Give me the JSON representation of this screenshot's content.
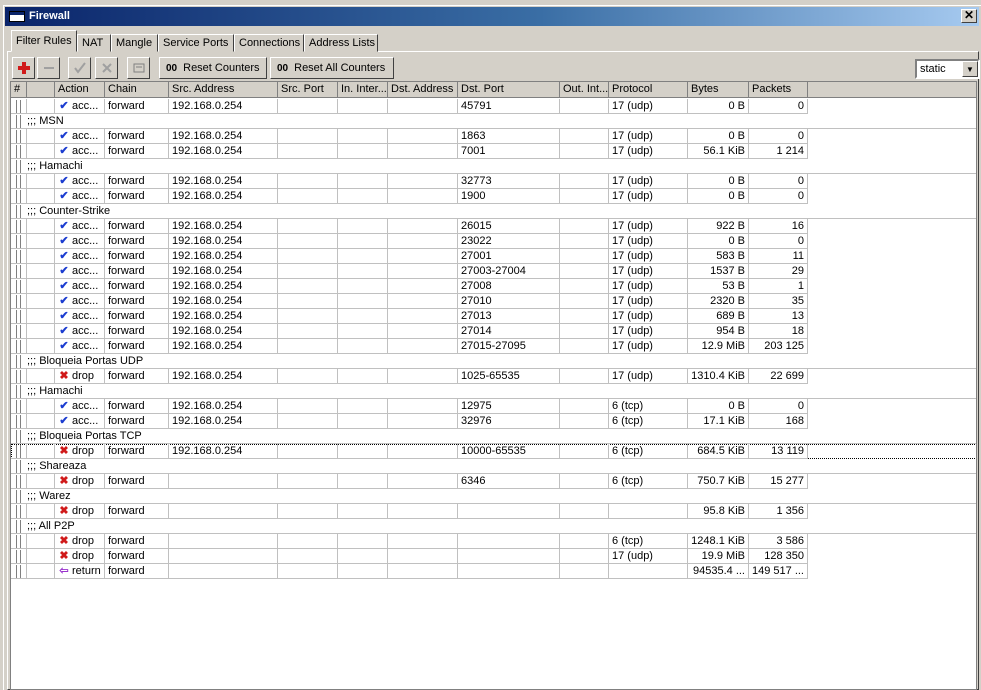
{
  "window": {
    "title": "Firewall",
    "close_label": "✕"
  },
  "tabs": [
    {
      "label": "Filter Rules"
    },
    {
      "label": "NAT"
    },
    {
      "label": "Mangle"
    },
    {
      "label": "Service Ports"
    },
    {
      "label": "Connections"
    },
    {
      "label": "Address Lists"
    }
  ],
  "toolbar": {
    "add_icon": "plus-icon",
    "remove_icon": "minus-icon",
    "enable_icon": "check-icon",
    "disable_icon": "cross-icon",
    "comment_icon": "comment-icon",
    "reset_counters_prefix": "00",
    "reset_counters_label": "Reset Counters",
    "reset_all_counters_prefix": "00",
    "reset_all_counters_label": "Reset All Counters",
    "filter_value": "static"
  },
  "columns": [
    {
      "label": "#"
    },
    {
      "label": "Action"
    },
    {
      "label": "Chain"
    },
    {
      "label": "Src. Address"
    },
    {
      "label": "Src. Port"
    },
    {
      "label": "In. Inter..."
    },
    {
      "label": "Dst. Address"
    },
    {
      "label": "Dst. Port"
    },
    {
      "label": "Out. Int..."
    },
    {
      "label": "Protocol"
    },
    {
      "label": "Bytes"
    },
    {
      "label": "Packets"
    }
  ],
  "colors": {
    "accept": "#1b3cd0",
    "drop": "#d01a1a",
    "return": "#9933cc"
  },
  "rows": [
    {
      "kind": "rule",
      "action": "acc...",
      "icon": "accept",
      "chain": "forward",
      "src": "192.168.0.254",
      "dst_port": "45791",
      "protocol": "17 (udp)",
      "bytes": "0 B",
      "packets": "0"
    },
    {
      "kind": "comment",
      "text": ";;; MSN"
    },
    {
      "kind": "rule",
      "action": "acc...",
      "icon": "accept",
      "chain": "forward",
      "src": "192.168.0.254",
      "dst_port": "1863",
      "protocol": "17 (udp)",
      "bytes": "0 B",
      "packets": "0"
    },
    {
      "kind": "rule",
      "action": "acc...",
      "icon": "accept",
      "chain": "forward",
      "src": "192.168.0.254",
      "dst_port": "7001",
      "protocol": "17 (udp)",
      "bytes": "56.1 KiB",
      "packets": "1 214"
    },
    {
      "kind": "comment",
      "text": ";;; Hamachi"
    },
    {
      "kind": "rule",
      "action": "acc...",
      "icon": "accept",
      "chain": "forward",
      "src": "192.168.0.254",
      "dst_port": "32773",
      "protocol": "17 (udp)",
      "bytes": "0 B",
      "packets": "0"
    },
    {
      "kind": "rule",
      "action": "acc...",
      "icon": "accept",
      "chain": "forward",
      "src": "192.168.0.254",
      "dst_port": "1900",
      "protocol": "17 (udp)",
      "bytes": "0 B",
      "packets": "0"
    },
    {
      "kind": "comment",
      "text": ";;; Counter-Strike"
    },
    {
      "kind": "rule",
      "action": "acc...",
      "icon": "accept",
      "chain": "forward",
      "src": "192.168.0.254",
      "dst_port": "26015",
      "protocol": "17 (udp)",
      "bytes": "922 B",
      "packets": "16"
    },
    {
      "kind": "rule",
      "action": "acc...",
      "icon": "accept",
      "chain": "forward",
      "src": "192.168.0.254",
      "dst_port": "23022",
      "protocol": "17 (udp)",
      "bytes": "0 B",
      "packets": "0"
    },
    {
      "kind": "rule",
      "action": "acc...",
      "icon": "accept",
      "chain": "forward",
      "src": "192.168.0.254",
      "dst_port": "27001",
      "protocol": "17 (udp)",
      "bytes": "583 B",
      "packets": "11"
    },
    {
      "kind": "rule",
      "action": "acc...",
      "icon": "accept",
      "chain": "forward",
      "src": "192.168.0.254",
      "dst_port": "27003-27004",
      "protocol": "17 (udp)",
      "bytes": "1537 B",
      "packets": "29"
    },
    {
      "kind": "rule",
      "action": "acc...",
      "icon": "accept",
      "chain": "forward",
      "src": "192.168.0.254",
      "dst_port": "27008",
      "protocol": "17 (udp)",
      "bytes": "53 B",
      "packets": "1"
    },
    {
      "kind": "rule",
      "action": "acc...",
      "icon": "accept",
      "chain": "forward",
      "src": "192.168.0.254",
      "dst_port": "27010",
      "protocol": "17 (udp)",
      "bytes": "2320 B",
      "packets": "35"
    },
    {
      "kind": "rule",
      "action": "acc...",
      "icon": "accept",
      "chain": "forward",
      "src": "192.168.0.254",
      "dst_port": "27013",
      "protocol": "17 (udp)",
      "bytes": "689 B",
      "packets": "13"
    },
    {
      "kind": "rule",
      "action": "acc...",
      "icon": "accept",
      "chain": "forward",
      "src": "192.168.0.254",
      "dst_port": "27014",
      "protocol": "17 (udp)",
      "bytes": "954 B",
      "packets": "18"
    },
    {
      "kind": "rule",
      "action": "acc...",
      "icon": "accept",
      "chain": "forward",
      "src": "192.168.0.254",
      "dst_port": "27015-27095",
      "protocol": "17 (udp)",
      "bytes": "12.9 MiB",
      "packets": "203 125"
    },
    {
      "kind": "comment",
      "text": ";;; Bloqueia Portas UDP"
    },
    {
      "kind": "rule",
      "action": "drop",
      "icon": "drop",
      "chain": "forward",
      "src": "192.168.0.254",
      "dst_port": "1025-65535",
      "protocol": "17 (udp)",
      "bytes": "1310.4 KiB",
      "packets": "22 699"
    },
    {
      "kind": "comment",
      "text": ";;; Hamachi"
    },
    {
      "kind": "rule",
      "action": "acc...",
      "icon": "accept",
      "chain": "forward",
      "src": "192.168.0.254",
      "dst_port": "12975",
      "protocol": "6 (tcp)",
      "bytes": "0 B",
      "packets": "0"
    },
    {
      "kind": "rule",
      "action": "acc...",
      "icon": "accept",
      "chain": "forward",
      "src": "192.168.0.254",
      "dst_port": "32976",
      "protocol": "6 (tcp)",
      "bytes": "17.1 KiB",
      "packets": "168"
    },
    {
      "kind": "comment",
      "text": ";;; Bloqueia Portas TCP"
    },
    {
      "kind": "rule",
      "selected": true,
      "action": "drop",
      "icon": "drop",
      "chain": "forward",
      "src": "192.168.0.254",
      "dst_port": "10000-65535",
      "protocol": "6 (tcp)",
      "bytes": "684.5 KiB",
      "packets": "13 119"
    },
    {
      "kind": "comment",
      "text": ";;; Shareaza"
    },
    {
      "kind": "rule",
      "action": "drop",
      "icon": "drop",
      "chain": "forward",
      "src": "",
      "dst_port": "6346",
      "protocol": "6 (tcp)",
      "bytes": "750.7 KiB",
      "packets": "15 277"
    },
    {
      "kind": "comment",
      "text": ";;; Warez"
    },
    {
      "kind": "rule",
      "action": "drop",
      "icon": "drop",
      "chain": "forward",
      "src": "",
      "dst_port": "",
      "protocol": "",
      "bytes": "95.8 KiB",
      "packets": "1 356"
    },
    {
      "kind": "comment",
      "text": ";;; All P2P"
    },
    {
      "kind": "rule",
      "action": "drop",
      "icon": "drop",
      "chain": "forward",
      "src": "",
      "dst_port": "",
      "protocol": "6 (tcp)",
      "bytes": "1248.1 KiB",
      "packets": "3 586"
    },
    {
      "kind": "rule",
      "action": "drop",
      "icon": "drop",
      "chain": "forward",
      "src": "",
      "dst_port": "",
      "protocol": "17 (udp)",
      "bytes": "19.9 MiB",
      "packets": "128 350"
    },
    {
      "kind": "rule",
      "action": "return",
      "icon": "return",
      "chain": "forward",
      "src": "",
      "dst_port": "",
      "protocol": "",
      "bytes": "94535.4 ...",
      "packets": "149 517 ..."
    }
  ]
}
